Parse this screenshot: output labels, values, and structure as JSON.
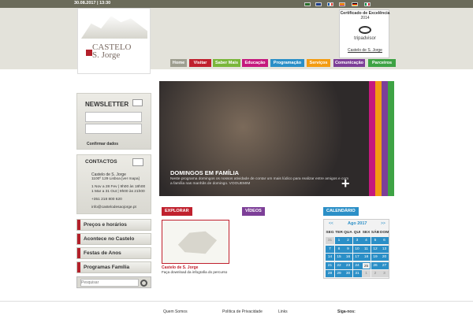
{
  "topbar": {
    "date": "30.08.2017 | 13:30"
  },
  "logo": {
    "line1": "CASTELO",
    "line2": "S. Jorge"
  },
  "nav": {
    "tabs": [
      {
        "label": "Home",
        "color": "#9e9e90"
      },
      {
        "label": "Visitar",
        "color": "#c0202d"
      },
      {
        "label": "Saber Mais",
        "color": "#7ab63a"
      },
      {
        "label": "Educação",
        "color": "#c5197d"
      },
      {
        "label": "Programação",
        "color": "#2b8fc7"
      },
      {
        "label": "Serviços",
        "color": "#f39c12"
      },
      {
        "label": "Comunicação",
        "color": "#7d3f98"
      },
      {
        "label": "Parceiros",
        "color": "#3ea344"
      }
    ]
  },
  "cert": {
    "title": "Certificado de Excelência",
    "year": "2014",
    "brand": "tripadvisor",
    "link": "Castelo de S. Jorge"
  },
  "newsletter": {
    "title": "NEWSLETTER",
    "confirm": "Confirmar dados"
  },
  "contacts": {
    "title": "CONTACTOS",
    "address": "Castelo de S. Jorge",
    "address2": "1100º 129 Lisboa [ver mapa]",
    "hours1": "1 Nov a 28 Fev | 9h00 às 18h00",
    "hours2": "1 Mar a 31 Out | 9h00 às 21h00",
    "phone": "+351 218 800 620",
    "email": "info@castelodesaojorge.pt"
  },
  "sidebar": {
    "items": [
      "Preços e horários",
      "Acontece no Castelo",
      "Festas de Anos",
      "Programas Família"
    ]
  },
  "search": {
    "placeholder": "Pesquisar"
  },
  "hero": {
    "title": "DOMINGOS EM FAMÍLIA",
    "text": "Neste programa domingos os nossos atividade de contar um mais lúdico para realizar entre amigos e com a família nas manhãs de domingo. VOOUEMIM"
  },
  "sections": {
    "explorar": "EXPLORAR",
    "videos": "VÍDEOS",
    "calendario": "CALENDÁRIO"
  },
  "explorar": {
    "caption": "Castelo de S. Jorge",
    "desc": "Faça download da infografia do percurso"
  },
  "calendar": {
    "month": "Ago 2017",
    "prev": "<<",
    "next": ">>",
    "days": [
      "SEG",
      "TER",
      "QUA",
      "QUI",
      "SEX",
      "SÁB",
      "DOM"
    ],
    "weeks": [
      [
        "31",
        "1",
        "2",
        "3",
        "4",
        "5",
        "6"
      ],
      [
        "7",
        "8",
        "9",
        "10",
        "11",
        "12",
        "13"
      ],
      [
        "14",
        "15",
        "16",
        "17",
        "18",
        "19",
        "20"
      ],
      [
        "21",
        "22",
        "23",
        "24",
        "25",
        "26",
        "27"
      ],
      [
        "28",
        "29",
        "30",
        "31",
        "1",
        "2",
        "3"
      ]
    ]
  },
  "footer": {
    "links": [
      "Quem Somos",
      "Política de Privacidade",
      "Links",
      "Siga-nos:"
    ]
  },
  "colors": {
    "accent": "#b3202a",
    "stripe": [
      "#c5197d",
      "#f39c12",
      "#7d3f98",
      "#3ea344"
    ]
  }
}
